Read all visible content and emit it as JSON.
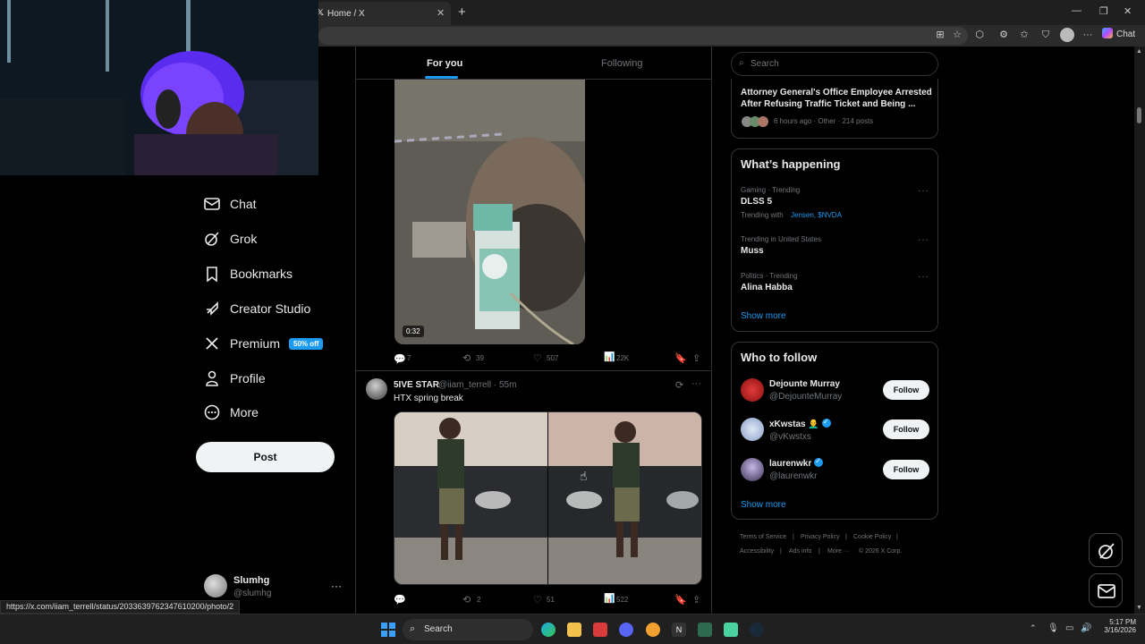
{
  "browser": {
    "tab_title": "Home / X",
    "chat_label": "Chat"
  },
  "nav": {
    "items": [
      {
        "label": "Chat",
        "icon": "mail-icon"
      },
      {
        "label": "Grok",
        "icon": "grok-icon"
      },
      {
        "label": "Bookmarks",
        "icon": "bookmark-icon"
      },
      {
        "label": "Creator Studio",
        "icon": "rocket-icon"
      },
      {
        "label": "Premium",
        "icon": "x-logo-icon"
      },
      {
        "label": "Profile",
        "icon": "person-icon"
      },
      {
        "label": "More",
        "icon": "more-circle-icon"
      }
    ],
    "premium_badge": "50% off",
    "post_label": "Post",
    "account": {
      "name": "Slumhg",
      "handle": "@slumhg",
      "more": "···"
    }
  },
  "feed": {
    "tabs": {
      "for_you": "For you",
      "following": "Following"
    },
    "tweet1": {
      "video_duration": "0:32",
      "replies": "7",
      "reposts": "39",
      "likes": "507",
      "views": "22K"
    },
    "tweet2": {
      "name": "5IVE STAR",
      "handle": "@iiam_terrell · 55m",
      "text": "HTX spring break",
      "replies": "",
      "reposts": "2",
      "likes": "51",
      "views": "522"
    }
  },
  "sidebar": {
    "search_placeholder": "Search",
    "news": {
      "headline_line1": "Attorney General's Office Employee Arrested",
      "headline_line2": "After Refusing Traffic Ticket and Being ...",
      "meta": "6 hours ago · Other · 214 posts"
    },
    "happening": {
      "title": "What’s happening",
      "trends": [
        {
          "context": "Gaming · Trending",
          "name": "DLSS 5",
          "extra_prefix": "Trending with",
          "extra_links": "Jensen, $NVDA"
        },
        {
          "context": "Trending in United States",
          "name": "Muss"
        },
        {
          "context": "Politics · Trending",
          "name": "Alina Habba"
        }
      ],
      "show_more": "Show more"
    },
    "who_to_follow": {
      "title": "Who to follow",
      "users": [
        {
          "name": "Dejounte Murray",
          "handle": "@DejounteMurray",
          "button": "Follow"
        },
        {
          "name": "xKwstas 👨‍🦲",
          "handle": "@vKwstxs",
          "button": "Follow"
        },
        {
          "name": "laurenwkr",
          "handle": "@laurenwkr",
          "button": "Follow"
        }
      ],
      "show_more": "Show more"
    },
    "footer": {
      "links": [
        "Terms of Service",
        "Privacy Policy",
        "Cookie Policy",
        "Accessibility",
        "Ads info",
        "More ···",
        "© 2026 X Corp."
      ]
    }
  },
  "status_bar_url": "https://x.com/iiam_terrell/status/2033639762347610200/photo/2",
  "taskbar": {
    "search_label": "Search",
    "time": "5:17 PM",
    "date": "3/16/2026"
  },
  "colors": {
    "accent": "#1d9bf0",
    "background": "#000000",
    "border": "#2f3336",
    "muted": "#71767b"
  }
}
